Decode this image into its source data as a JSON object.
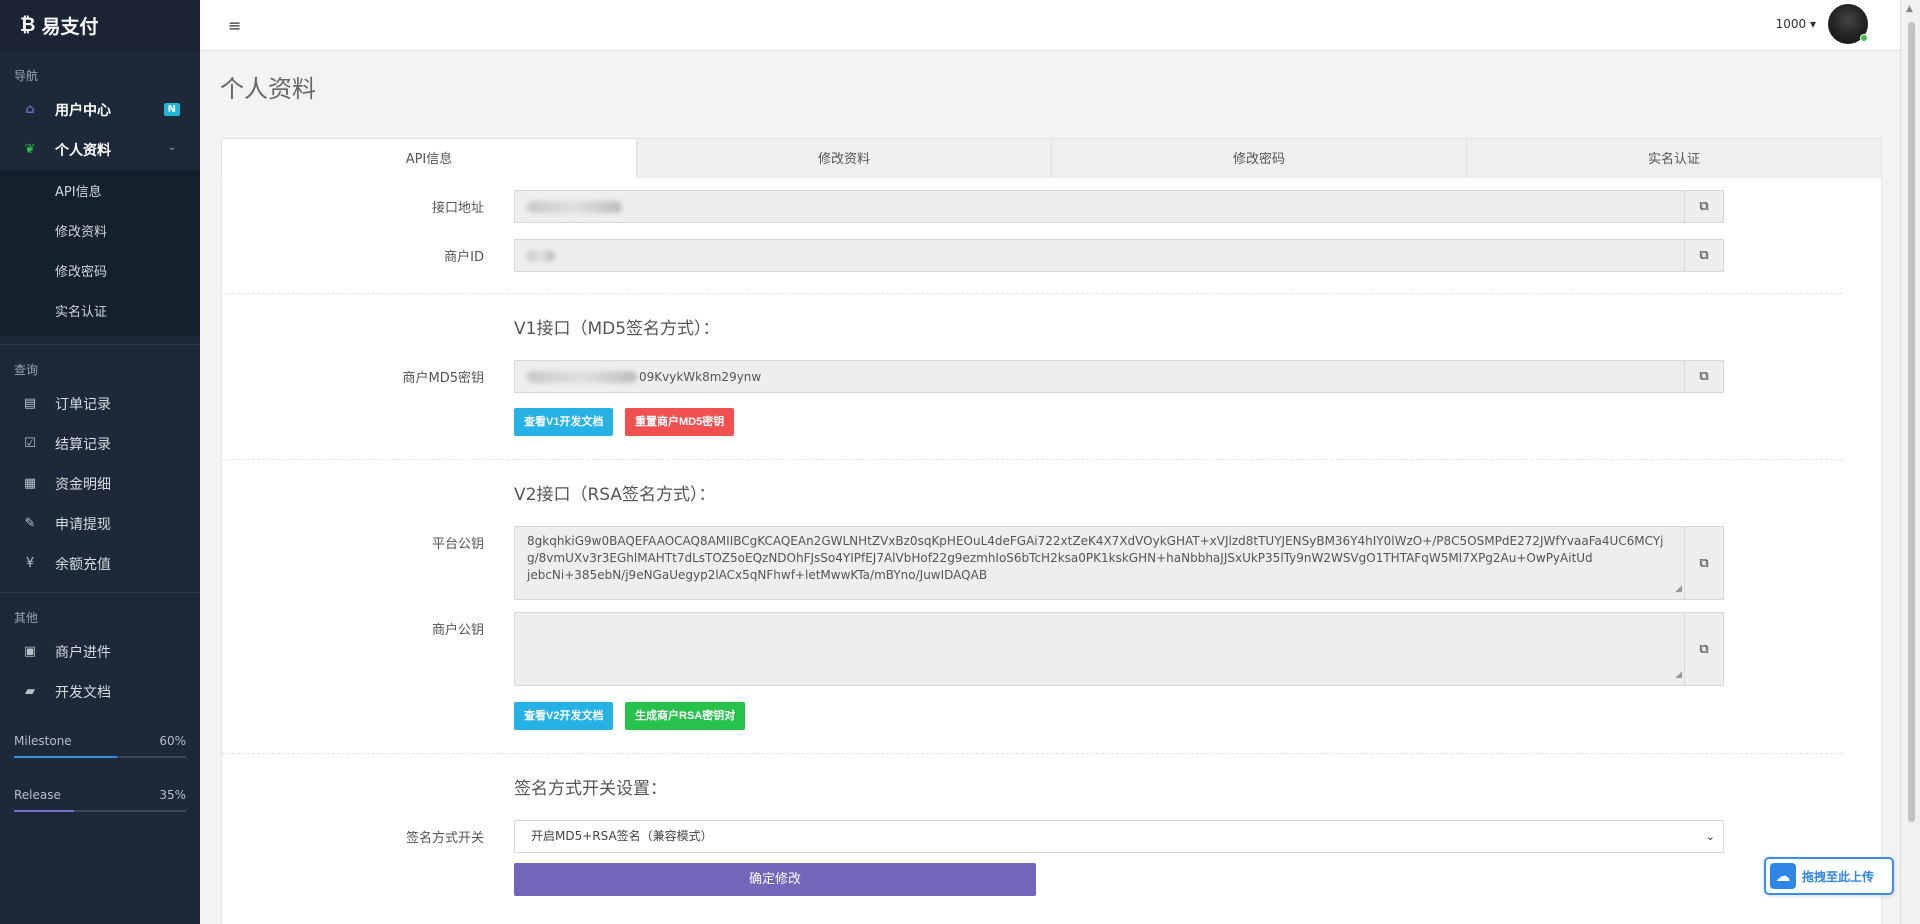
{
  "brand": {
    "logo": "₿",
    "name": "易支付"
  },
  "sidebar": {
    "nav_heading": "导航",
    "nav": [
      {
        "label": "用户中心",
        "icon": "home-icon",
        "badge": "N"
      },
      {
        "label": "个人资料",
        "icon": "leaf-icon"
      }
    ],
    "submenu": [
      "API信息",
      "修改资料",
      "修改密码",
      "实名认证"
    ],
    "query_heading": "查询",
    "query": [
      {
        "label": "订单记录",
        "icon": "list-icon"
      },
      {
        "label": "结算记录",
        "icon": "check-square-icon"
      },
      {
        "label": "资金明细",
        "icon": "calendar-icon"
      },
      {
        "label": "申请提现",
        "icon": "edit-icon"
      },
      {
        "label": "余额充值",
        "icon": "yen-icon"
      }
    ],
    "other_heading": "其他",
    "other": [
      {
        "label": "商户进件",
        "icon": "id-card-icon"
      },
      {
        "label": "开发文档",
        "icon": "book-icon"
      }
    ],
    "progress": [
      {
        "label": "Milestone",
        "value": "60%",
        "fraction": 0.6
      },
      {
        "label": "Release",
        "value": "35%",
        "fraction": 0.35
      }
    ]
  },
  "topbar": {
    "menu_icon": "≡",
    "user_label": "1000 ▾"
  },
  "page": {
    "title": "个人资料"
  },
  "tabs": [
    "API信息",
    "修改资料",
    "修改密码",
    "实名认证"
  ],
  "form": {
    "api_url_label": "接口地址",
    "merchant_id_label": "商户ID",
    "v1_title": "V1接口（MD5签名方式）：",
    "md5_label": "商户MD5密钥",
    "md5_value_visible": "09KvykWk8m29ynw",
    "v1_doc_btn": "查看V1开发文档",
    "reset_md5_btn": "重置商户MD5密钥",
    "v2_title": "V2接口（RSA签名方式）：",
    "platform_key_label": "平台公钥",
    "platform_key_line1": "8gkqhkiG9w0BAQEFAAOCAQ8AMIIBCgKCAQEAn2GWLNHtZVxBz0sqKpHEOuL4deFGAi722xtZeK4X7XdVOykGHAT+xVJlzd8tTUYJENSyBM36Y4hIY0lWzO+/P8C5OSMPdE272JWfYvaaFa4UC6MCYj",
    "platform_key_line2": "g/8vmUXv3r3EGhlMAHTt7dLsTOZ5oEQzNDOhFJsSo4YIPfEJ7AlVbHof22g9ezmhIoS6bTcH2ksa0PK1kskGHN+haNbbhaJJSxUkP35lTy9nW2WSVgO1THTAFqW5MI7XPg2Au+OwPyAitUd",
    "platform_key_line3": "jebcNi+385ebN/j9eNGaUegyp2lACx5qNFhwf+letMwwKTa/mBYno/JuwIDAQAB",
    "merchant_key_label": "商户公钥",
    "v2_doc_btn": "查看V2开发文档",
    "gen_rsa_btn": "生成商户RSA密钥对",
    "sign_title": "签名方式开关设置：",
    "sign_label": "签名方式开关",
    "sign_selected": "开启MD5+RSA签名（兼容模式）",
    "submit_btn": "确定修改"
  },
  "upload": {
    "label": "拖拽至此上传"
  }
}
